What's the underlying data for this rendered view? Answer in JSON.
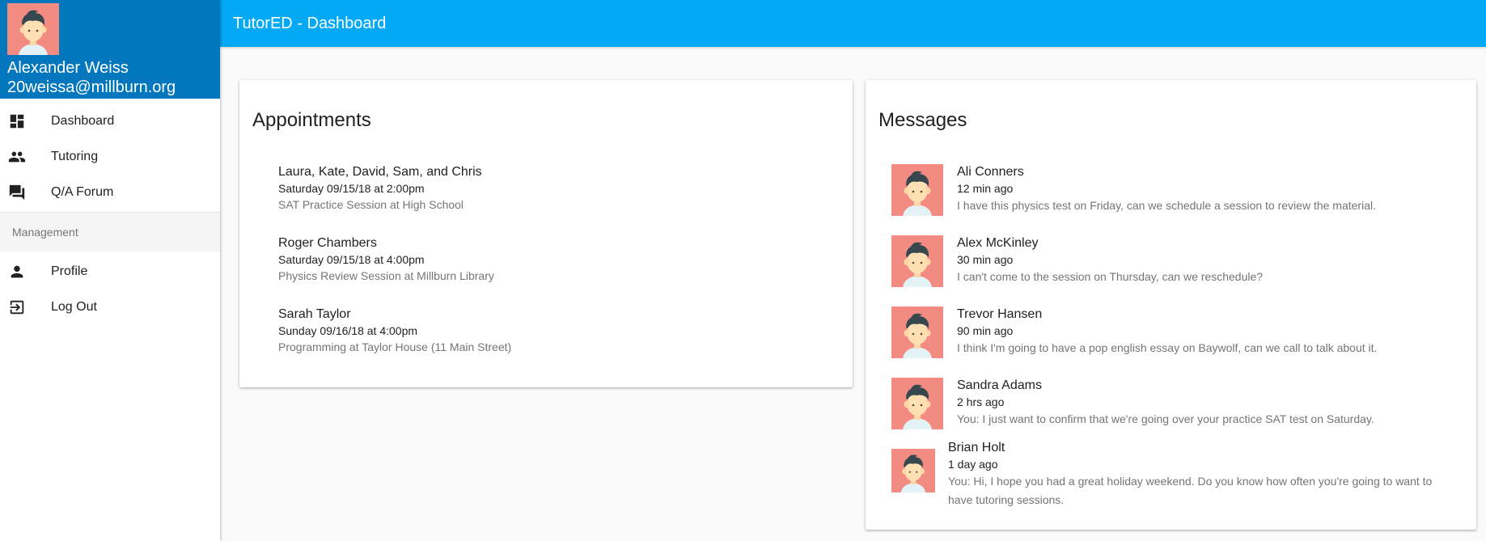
{
  "app": {
    "title": "TutorED - Dashboard"
  },
  "user": {
    "name": "Alexander Weiss",
    "email": "20weissa@millburn.org"
  },
  "colors": {
    "sidebar_header": "#0277bd",
    "topbar": "#03a9f4",
    "avatar_bg": "#f28b82"
  },
  "nav": {
    "main": [
      {
        "label": "Dashboard",
        "icon": "dashboard-icon"
      },
      {
        "label": "Tutoring",
        "icon": "people-icon"
      },
      {
        "label": "Q/A Forum",
        "icon": "forum-icon"
      }
    ],
    "subheader": "Management",
    "management": [
      {
        "label": "Profile",
        "icon": "person-icon"
      },
      {
        "label": "Log Out",
        "icon": "logout-icon"
      }
    ]
  },
  "appointments": {
    "title": "Appointments",
    "items": [
      {
        "people": "Laura, Kate, David, Sam, and Chris",
        "when": "Saturday 09/15/18 at 2:00pm",
        "what": "SAT Practice Session at High School"
      },
      {
        "people": "Roger Chambers",
        "when": "Saturday 09/15/18 at 4:00pm",
        "what": "Physics Review Session at Millburn Library"
      },
      {
        "people": "Sarah Taylor",
        "when": "Sunday 09/16/18 at 4:00pm",
        "what": "Programming at Taylor House (11 Main Street)"
      }
    ]
  },
  "messages": {
    "title": "Messages",
    "items": [
      {
        "from": "Ali Conners",
        "time": "12 min ago",
        "text": "I have this physics test on Friday, can we schedule a session to review the material."
      },
      {
        "from": "Alex McKinley",
        "time": "30 min ago",
        "text": "I can't come to the session on Thursday, can we reschedule?"
      },
      {
        "from": "Trevor Hansen",
        "time": "90 min ago",
        "text": "I think I'm going to have a pop english essay on Baywolf, can we call to talk about it."
      },
      {
        "from": "Sandra Adams",
        "time": "2 hrs ago",
        "text": "You: I just want to confirm that we're going over your practice SAT test on Saturday."
      },
      {
        "from": "Brian Holt",
        "time": "1 day ago",
        "text": "You: Hi, I hope you had a great holiday weekend. Do you know how often you're going to want to have tutoring sessions."
      }
    ]
  }
}
